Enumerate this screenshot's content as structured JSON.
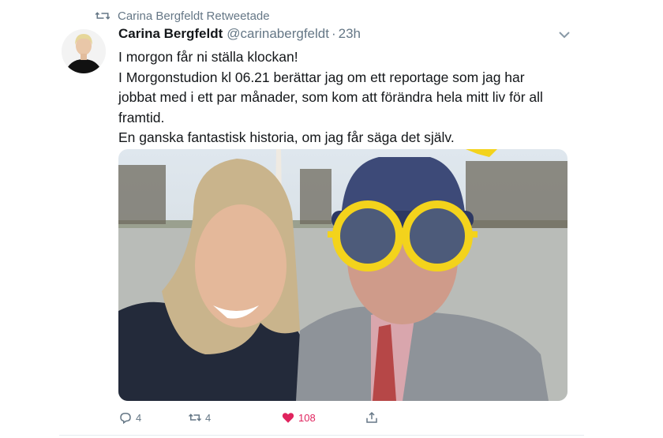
{
  "retweet_banner": {
    "text": "Carina Bergfeldt Retweetade",
    "icon": "retweet-icon"
  },
  "author": {
    "display_name": "Carina Bergfeldt",
    "handle": "@carinabergfeldt",
    "separator": "·",
    "time": "23h"
  },
  "tweet": {
    "lines": [
      "I morgon får ni ställa klockan!",
      "I Morgonstudion kl 06.21 berättar jag om ett reportage som jag har",
      "jobbat med i ett par månader, som kom att förändra hela mitt liv för all",
      "framtid.",
      "En ganska fantastisk historia, om jag får säga det själv."
    ]
  },
  "actions": {
    "reply": {
      "icon": "reply-icon",
      "count": "4"
    },
    "retweet": {
      "icon": "retweet-icon",
      "count": "4"
    },
    "like": {
      "icon": "heart-icon",
      "count": "108",
      "color": "#e0245e"
    },
    "share": {
      "icon": "share-icon"
    }
  },
  "colors": {
    "secondary": "#657786",
    "primary_text": "#14171a",
    "like": "#e0245e",
    "divider": "#e6ecf0"
  }
}
